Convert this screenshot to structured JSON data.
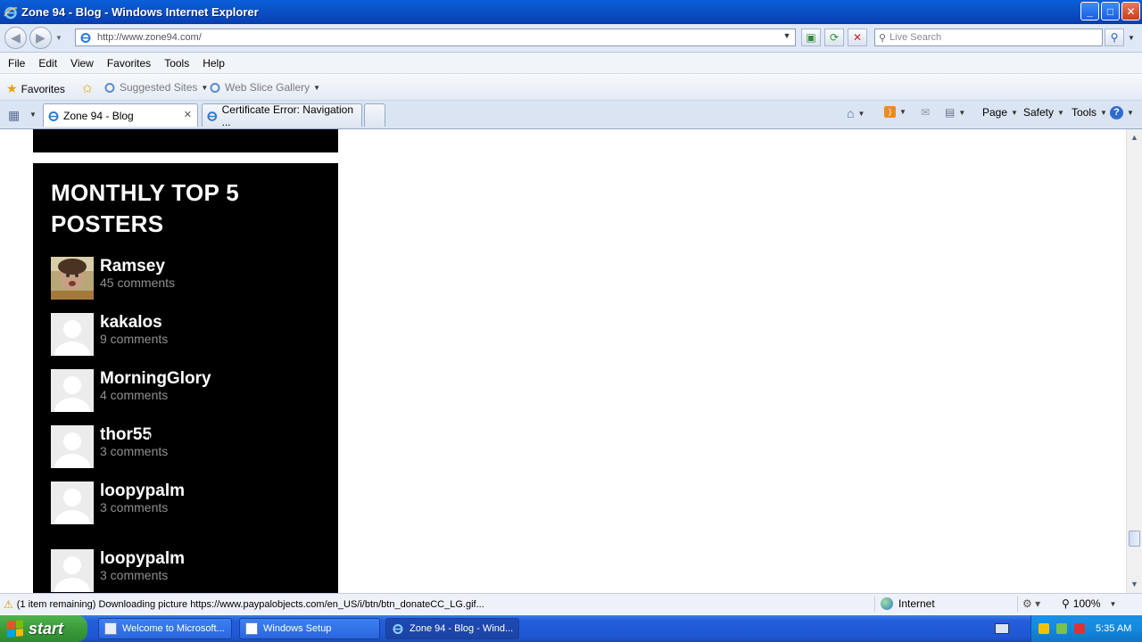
{
  "window": {
    "title": "Zone 94 - Blog - Windows Internet Explorer",
    "buttons": {
      "minimize": "_",
      "maximize": "□",
      "close": "✕"
    }
  },
  "address": {
    "url": "http://www.zone94.com/",
    "search_placeholder": "Live Search"
  },
  "menu": [
    "File",
    "Edit",
    "View",
    "Favorites",
    "Tools",
    "Help"
  ],
  "favorites_bar": {
    "favorites_label": "Favorites",
    "suggested_sites": "Suggested Sites",
    "web_slice_gallery": "Web Slice Gallery"
  },
  "tabs": [
    {
      "label": "Zone 94 - Blog",
      "close": "✕"
    },
    {
      "label": "Certificate Error: Navigation ..."
    }
  ],
  "command_bar": {
    "page": "Page",
    "safety": "Safety",
    "tools": "Tools"
  },
  "widget": {
    "title": "MONTHLY TOP 5 POSTERS",
    "posters": [
      {
        "name": "Ramsey",
        "count": "45 comments"
      },
      {
        "name": "kakalos",
        "count": "9 comments"
      },
      {
        "name": "MorningGlory",
        "count": "4 comments"
      },
      {
        "name": "thor55",
        "count": "3 comments"
      },
      {
        "name": "loopypalm",
        "count": "3 comments"
      },
      {
        "name": "loopypalm",
        "count": "3 comments"
      }
    ]
  },
  "status": {
    "text": "(1 item remaining) Downloading picture https://www.paypalobjects.com/en_US/i/btn/btn_donateCC_LG.gif...",
    "zone": "Internet",
    "zoom": "100%"
  },
  "taskbar": {
    "start": "start",
    "items": [
      {
        "label": "Welcome to Microsoft..."
      },
      {
        "label": "Windows Setup"
      },
      {
        "label": "Zone 94 - Blog - Wind..."
      }
    ],
    "clock": "5:35 AM"
  },
  "colors": {
    "titlebar": "#0b53c6",
    "widget_bg": "#000000",
    "taskbar": "#245edb",
    "start": "#3a9c3a"
  }
}
